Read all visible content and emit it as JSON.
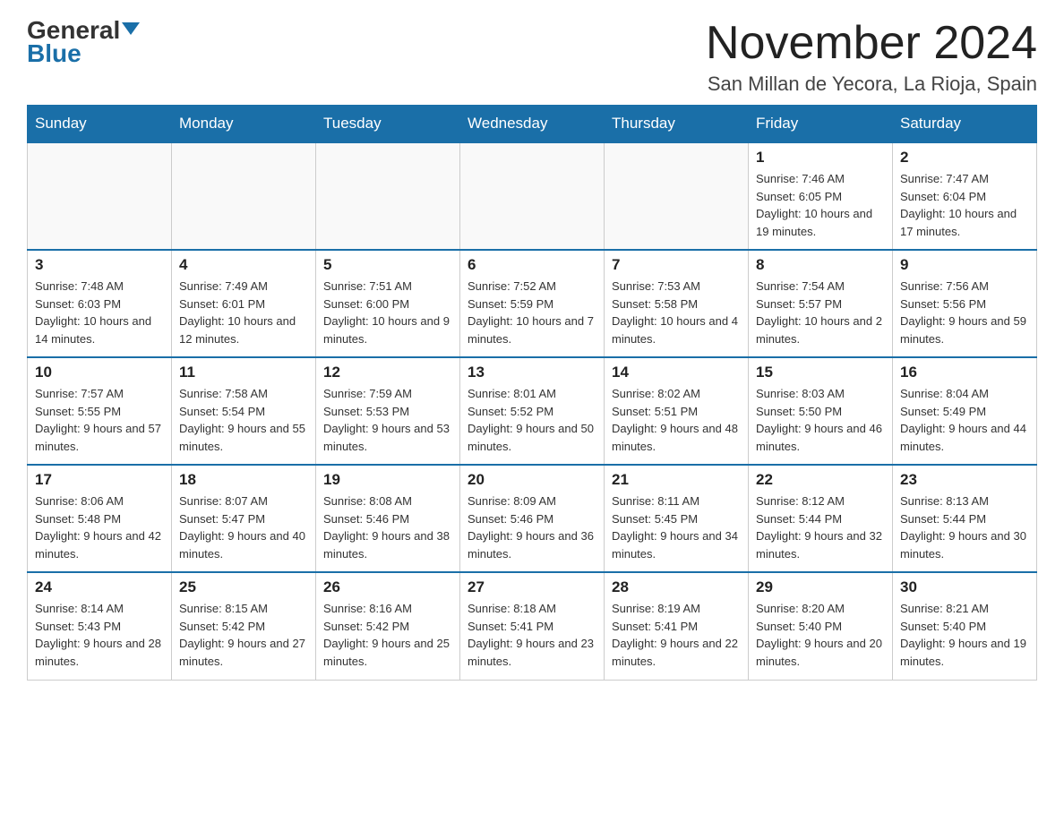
{
  "header": {
    "logo_general": "General",
    "logo_blue": "Blue",
    "month_title": "November 2024",
    "location": "San Millan de Yecora, La Rioja, Spain"
  },
  "weekdays": [
    "Sunday",
    "Monday",
    "Tuesday",
    "Wednesday",
    "Thursday",
    "Friday",
    "Saturday"
  ],
  "weeks": [
    [
      {
        "day": "",
        "sunrise": "",
        "sunset": "",
        "daylight": ""
      },
      {
        "day": "",
        "sunrise": "",
        "sunset": "",
        "daylight": ""
      },
      {
        "day": "",
        "sunrise": "",
        "sunset": "",
        "daylight": ""
      },
      {
        "day": "",
        "sunrise": "",
        "sunset": "",
        "daylight": ""
      },
      {
        "day": "",
        "sunrise": "",
        "sunset": "",
        "daylight": ""
      },
      {
        "day": "1",
        "sunrise": "Sunrise: 7:46 AM",
        "sunset": "Sunset: 6:05 PM",
        "daylight": "Daylight: 10 hours and 19 minutes."
      },
      {
        "day": "2",
        "sunrise": "Sunrise: 7:47 AM",
        "sunset": "Sunset: 6:04 PM",
        "daylight": "Daylight: 10 hours and 17 minutes."
      }
    ],
    [
      {
        "day": "3",
        "sunrise": "Sunrise: 7:48 AM",
        "sunset": "Sunset: 6:03 PM",
        "daylight": "Daylight: 10 hours and 14 minutes."
      },
      {
        "day": "4",
        "sunrise": "Sunrise: 7:49 AM",
        "sunset": "Sunset: 6:01 PM",
        "daylight": "Daylight: 10 hours and 12 minutes."
      },
      {
        "day": "5",
        "sunrise": "Sunrise: 7:51 AM",
        "sunset": "Sunset: 6:00 PM",
        "daylight": "Daylight: 10 hours and 9 minutes."
      },
      {
        "day": "6",
        "sunrise": "Sunrise: 7:52 AM",
        "sunset": "Sunset: 5:59 PM",
        "daylight": "Daylight: 10 hours and 7 minutes."
      },
      {
        "day": "7",
        "sunrise": "Sunrise: 7:53 AM",
        "sunset": "Sunset: 5:58 PM",
        "daylight": "Daylight: 10 hours and 4 minutes."
      },
      {
        "day": "8",
        "sunrise": "Sunrise: 7:54 AM",
        "sunset": "Sunset: 5:57 PM",
        "daylight": "Daylight: 10 hours and 2 minutes."
      },
      {
        "day": "9",
        "sunrise": "Sunrise: 7:56 AM",
        "sunset": "Sunset: 5:56 PM",
        "daylight": "Daylight: 9 hours and 59 minutes."
      }
    ],
    [
      {
        "day": "10",
        "sunrise": "Sunrise: 7:57 AM",
        "sunset": "Sunset: 5:55 PM",
        "daylight": "Daylight: 9 hours and 57 minutes."
      },
      {
        "day": "11",
        "sunrise": "Sunrise: 7:58 AM",
        "sunset": "Sunset: 5:54 PM",
        "daylight": "Daylight: 9 hours and 55 minutes."
      },
      {
        "day": "12",
        "sunrise": "Sunrise: 7:59 AM",
        "sunset": "Sunset: 5:53 PM",
        "daylight": "Daylight: 9 hours and 53 minutes."
      },
      {
        "day": "13",
        "sunrise": "Sunrise: 8:01 AM",
        "sunset": "Sunset: 5:52 PM",
        "daylight": "Daylight: 9 hours and 50 minutes."
      },
      {
        "day": "14",
        "sunrise": "Sunrise: 8:02 AM",
        "sunset": "Sunset: 5:51 PM",
        "daylight": "Daylight: 9 hours and 48 minutes."
      },
      {
        "day": "15",
        "sunrise": "Sunrise: 8:03 AM",
        "sunset": "Sunset: 5:50 PM",
        "daylight": "Daylight: 9 hours and 46 minutes."
      },
      {
        "day": "16",
        "sunrise": "Sunrise: 8:04 AM",
        "sunset": "Sunset: 5:49 PM",
        "daylight": "Daylight: 9 hours and 44 minutes."
      }
    ],
    [
      {
        "day": "17",
        "sunrise": "Sunrise: 8:06 AM",
        "sunset": "Sunset: 5:48 PM",
        "daylight": "Daylight: 9 hours and 42 minutes."
      },
      {
        "day": "18",
        "sunrise": "Sunrise: 8:07 AM",
        "sunset": "Sunset: 5:47 PM",
        "daylight": "Daylight: 9 hours and 40 minutes."
      },
      {
        "day": "19",
        "sunrise": "Sunrise: 8:08 AM",
        "sunset": "Sunset: 5:46 PM",
        "daylight": "Daylight: 9 hours and 38 minutes."
      },
      {
        "day": "20",
        "sunrise": "Sunrise: 8:09 AM",
        "sunset": "Sunset: 5:46 PM",
        "daylight": "Daylight: 9 hours and 36 minutes."
      },
      {
        "day": "21",
        "sunrise": "Sunrise: 8:11 AM",
        "sunset": "Sunset: 5:45 PM",
        "daylight": "Daylight: 9 hours and 34 minutes."
      },
      {
        "day": "22",
        "sunrise": "Sunrise: 8:12 AM",
        "sunset": "Sunset: 5:44 PM",
        "daylight": "Daylight: 9 hours and 32 minutes."
      },
      {
        "day": "23",
        "sunrise": "Sunrise: 8:13 AM",
        "sunset": "Sunset: 5:44 PM",
        "daylight": "Daylight: 9 hours and 30 minutes."
      }
    ],
    [
      {
        "day": "24",
        "sunrise": "Sunrise: 8:14 AM",
        "sunset": "Sunset: 5:43 PM",
        "daylight": "Daylight: 9 hours and 28 minutes."
      },
      {
        "day": "25",
        "sunrise": "Sunrise: 8:15 AM",
        "sunset": "Sunset: 5:42 PM",
        "daylight": "Daylight: 9 hours and 27 minutes."
      },
      {
        "day": "26",
        "sunrise": "Sunrise: 8:16 AM",
        "sunset": "Sunset: 5:42 PM",
        "daylight": "Daylight: 9 hours and 25 minutes."
      },
      {
        "day": "27",
        "sunrise": "Sunrise: 8:18 AM",
        "sunset": "Sunset: 5:41 PM",
        "daylight": "Daylight: 9 hours and 23 minutes."
      },
      {
        "day": "28",
        "sunrise": "Sunrise: 8:19 AM",
        "sunset": "Sunset: 5:41 PM",
        "daylight": "Daylight: 9 hours and 22 minutes."
      },
      {
        "day": "29",
        "sunrise": "Sunrise: 8:20 AM",
        "sunset": "Sunset: 5:40 PM",
        "daylight": "Daylight: 9 hours and 20 minutes."
      },
      {
        "day": "30",
        "sunrise": "Sunrise: 8:21 AM",
        "sunset": "Sunset: 5:40 PM",
        "daylight": "Daylight: 9 hours and 19 minutes."
      }
    ]
  ]
}
